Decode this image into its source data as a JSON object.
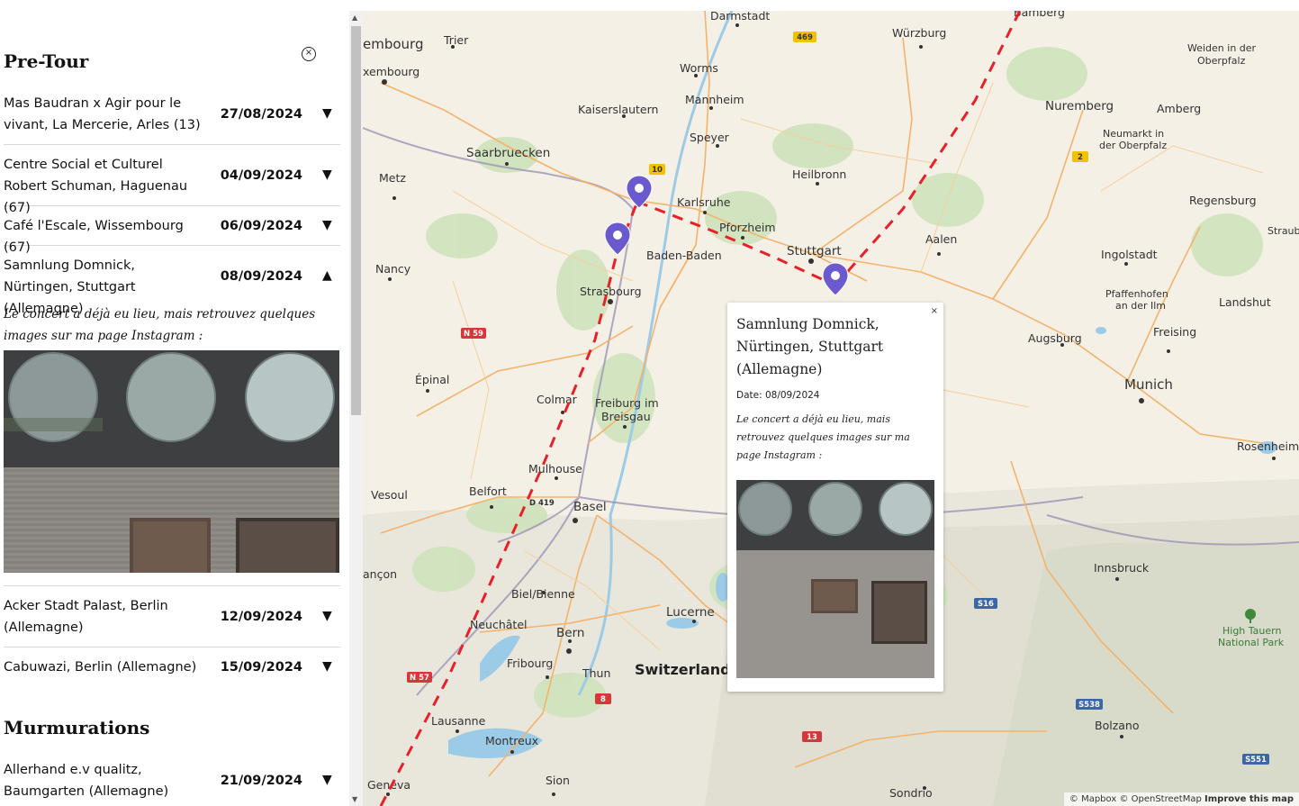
{
  "sidebar": {
    "close_icon": "×",
    "sections": [
      {
        "title": "Pre-Tour",
        "events": [
          {
            "venue": "Mas Baudran x Agir pour le vivant, La Mercerie, Arles (13)",
            "date": "27/08/2024",
            "arrow": "▼"
          },
          {
            "venue": "Centre Social et Culturel Robert Schuman, Haguenau (67)",
            "date": "04/09/2024",
            "arrow": "▼"
          },
          {
            "venue": "Café l'Escale, Wissembourg (67)",
            "date": "06/09/2024",
            "arrow": "▼"
          },
          {
            "venue": "Samnlung Domnick, Nürtingen, Stuttgart (Allemagne)",
            "date": "08/09/2024",
            "arrow": "▲",
            "details": "Le concert a déjà eu lieu, mais retrouvez quelques images sur ma page Instagram :"
          },
          {
            "venue": "Acker Stadt Palast, Berlin (Allemagne)",
            "date": "12/09/2024",
            "arrow": "▼"
          },
          {
            "venue": "Cabuwazi, Berlin (Allemagne)",
            "date": "15/09/2024",
            "arrow": "▼"
          }
        ]
      },
      {
        "title": "Murmurations",
        "events": [
          {
            "venue": "Allerhand e.v qualitz, Baumgarten (Allemagne)",
            "date": "21/09/2024",
            "arrow": "▼"
          }
        ]
      }
    ]
  },
  "map": {
    "cities": {
      "darmstadt": "Darmstadt",
      "bamberg": "Bamberg",
      "wurzburg": "Würzburg",
      "weiden": "Weiden in der",
      "oberpfalz": "Oberpfalz",
      "luxembourg1": "embourg",
      "luxembourg2": "xembourg",
      "trier": "Trier",
      "worms": "Worms",
      "mannheim": "Mannheim",
      "kaiserslautern": "Kaiserslautern",
      "nuremberg": "Nuremberg",
      "amberg": "Amberg",
      "neumarkt1": "Neumarkt in",
      "neumarkt2": "der Oberpfalz",
      "speyer": "Speyer",
      "saarbruecken": "Saarbruecken",
      "heilbronn": "Heilbronn",
      "metz": "Metz",
      "karlsruhe": "Karlsruhe",
      "regensburg": "Regensburg",
      "pforzheim": "Pforzheim",
      "straubing": "Straubi",
      "baden": "Baden-Baden",
      "stuttgart": "Stuttgart",
      "aalen": "Aalen",
      "nancy": "Nancy",
      "ingolstadt": "Ingolstadt",
      "strasbourg": "Strasbourg",
      "pfaffenhofen1": "Pfaffenhofen",
      "pfaffenhofen2": "an der Ilm",
      "landshut": "Landshut",
      "augsburg": "Augsburg",
      "freising": "Freising",
      "epinal": "Épinal",
      "munich": "Munich",
      "colmar": "Colmar",
      "freiburg1": "Freiburg im",
      "freiburg2": "Breisgau",
      "rosenheim": "Rosenheim",
      "mulhouse": "Mulhouse",
      "vesoul": "Vesoul",
      "belfort": "Belfort",
      "basel": "Basel",
      "besancon": "ançon",
      "innsbruck": "Innsbruck",
      "biel": "Biel/Bienne",
      "lucerne": "Lucerne",
      "neuchatel": "Neuchâtel",
      "bern": "Bern",
      "switzerland": "Switzerland",
      "fribourg": "Fribourg",
      "thun": "Thun",
      "hightauern1": "High Tauern",
      "hightauern2": "National Park",
      "lausanne": "Lausanne",
      "montreux": "Montreux",
      "bolzano": "Bolzano",
      "geneva": "Geneva",
      "sion": "Sion",
      "sondrio": "Sondrio"
    },
    "roads": {
      "r469": "469",
      "r10": "10",
      "r2": "2",
      "n59": "N 59",
      "d419": "D 419",
      "n57": "N 57",
      "r8": "8",
      "r13": "13",
      "s16": "S16",
      "s538": "S538",
      "s551": "S551"
    },
    "attribution": {
      "mapbox": "© Mapbox",
      "osm": "© OpenStreetMap",
      "improve": "Improve this map"
    },
    "marker_icon": "map-pin-icon"
  },
  "popup": {
    "close": "×",
    "title": "Samnlung Domnick, Nürtingen, Stuttgart (Allemagne)",
    "date": "Date: 08/09/2024",
    "description": "Le concert a déjà eu lieu, mais retrouvez quelques images sur ma page Instagram :"
  },
  "colors": {
    "route": "#e8202a",
    "marker": "#6a5acd",
    "water": "#9ccbe8",
    "forest": "#c9dfb4"
  }
}
